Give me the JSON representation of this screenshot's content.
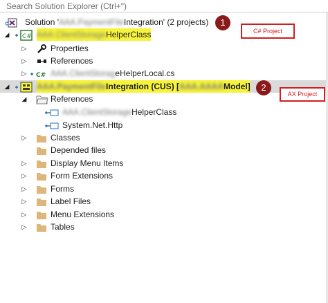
{
  "search": {
    "placeholder": "Search Solution Explorer (Ctrl+\")"
  },
  "solution": {
    "prefix": "Solution '",
    "hidden_name": "AAA.PaymentFile",
    "suffix": "Integration' (2 projects)"
  },
  "project1": {
    "hidden_name": "AAA.ClientStorage",
    "name_suffix": "HelperClass",
    "children": {
      "properties": "Properties",
      "references": "References",
      "file_hidden": "AAA.ClientStorag",
      "file_suffix": "eHelperLocal.cs"
    }
  },
  "project2": {
    "hidden_name": "AAA.PaymentFile",
    "name_mid": "Integration (CUS) [",
    "hidden_model": "AAA.AAAA",
    "name_end": "Model]",
    "references_label": "References",
    "ref1_hidden": "AAA.ClientStorage",
    "ref1_suffix": "HelperClass",
    "ref2": "System.Net.Http",
    "folders": [
      "Classes",
      "Depended files",
      "Display Menu Items",
      "Form Extensions",
      "Forms",
      "Label Files",
      "Menu Extensions",
      "Tables"
    ]
  },
  "annotations": {
    "badge1": "1",
    "badge2": "2",
    "note1": "C# Project",
    "note2": "AX Project"
  },
  "colors": {
    "highlight": "#f6f33a",
    "annotation_red": "#d11d1d",
    "badge_fill": "#8b1a1a",
    "selection": "#dadada",
    "csharp_green": "#2f7d32",
    "folder_tan": "#dcb67a"
  }
}
